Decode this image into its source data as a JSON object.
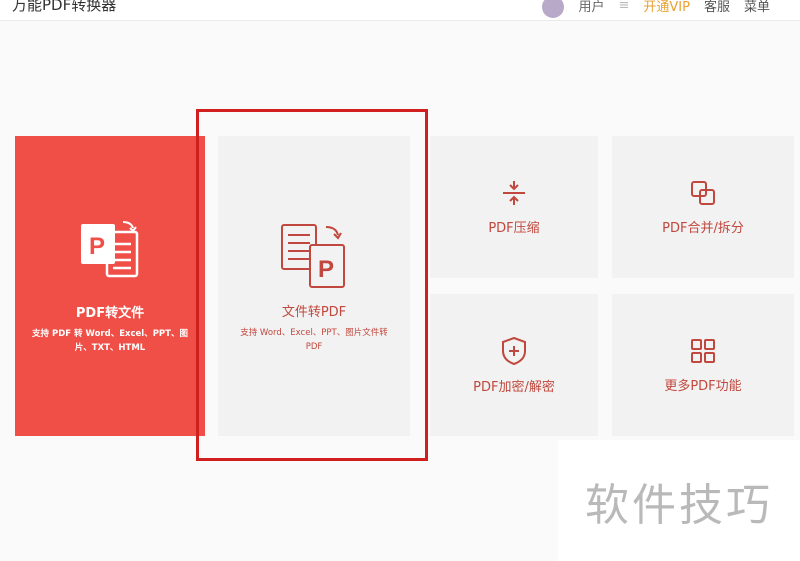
{
  "app": {
    "title": "万能PDF转换器"
  },
  "topbar": {
    "user_name": "用户",
    "menu_dot": "≡",
    "link_accent": "开通VIP",
    "link_1": "客服",
    "link_2": "菜单"
  },
  "cards": {
    "pdf_to_file": {
      "label": "PDF转文件",
      "desc": "支持 PDF 转 Word、Excel、PPT、图片、TXT、HTML"
    },
    "file_to_pdf": {
      "label": "文件转PDF",
      "desc": "支持 Word、Excel、PPT、图片文件转 PDF"
    },
    "compress": {
      "label": "PDF压缩"
    },
    "merge_split": {
      "label": "PDF合并/拆分"
    },
    "encrypt": {
      "label": "PDF加密/解密"
    },
    "more": {
      "label": "更多PDF功能"
    }
  },
  "watermark": {
    "text": "软件技巧"
  },
  "colors": {
    "accent_red": "#ef4f47",
    "highlight_red": "#d11f1f",
    "card_gray": "#f3f2f2",
    "icon_red": "#c0483e"
  }
}
